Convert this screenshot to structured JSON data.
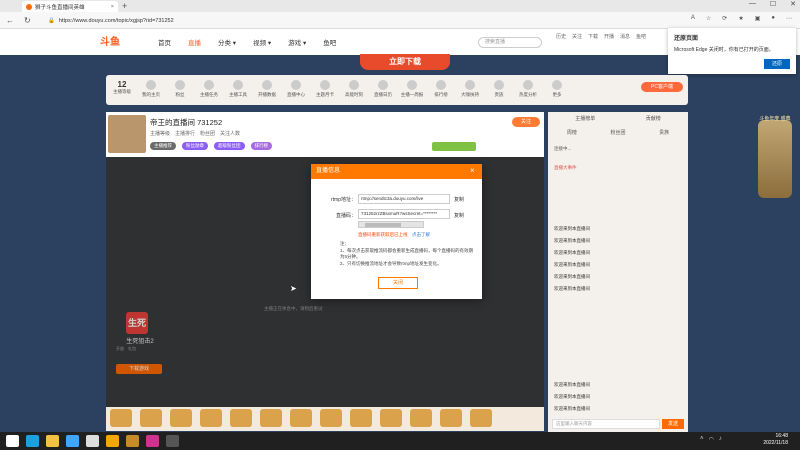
{
  "browser": {
    "tab_title": "狮子斗鱼直播间英雄",
    "tab_close": "×",
    "new_tab": "+",
    "url": "https://www.douyu.com/topic/xgjsp?rid=731252"
  },
  "site": {
    "logo": "斗鱼",
    "nav": [
      "首页",
      "直播",
      "分类 ▾",
      "视频 ▾",
      "游戏 ▾",
      "鱼吧"
    ],
    "banner": "立即下载",
    "search_placeholder": "搜索直播",
    "header_icons": [
      "历史",
      "关注",
      "下载",
      "开播",
      "消息",
      "鱼吧"
    ]
  },
  "toast": {
    "title": "还原页面",
    "message": "Microsoft Edge 关闭时，你有已打开的页面。",
    "button": "还原"
  },
  "categories": {
    "count": "12",
    "count_label": "主播等级",
    "items": [
      "我的主页",
      "粉丝",
      "主播任务",
      "主播工具",
      "开播数据",
      "直播中心",
      "主题月卡",
      "高能时刻",
      "直播日历",
      "主播一周报",
      "排行榜",
      "大咖扶持",
      "贵族",
      "热度分析",
      "更多"
    ],
    "pc_button": "PC客户端"
  },
  "room": {
    "title": "帝王的直播间 731252",
    "meta": [
      "主播等级",
      "主播排行",
      "粉丝团",
      "关注人数"
    ],
    "tags": [
      "主播推荐",
      "粉丝勋章",
      "超级粉丝团",
      "排行榜"
    ],
    "follow": "关注"
  },
  "player": {
    "status": "主播正在休息中，请稍后重试",
    "game_icon": "生死",
    "game_name": "生死狙击2",
    "game_sub": [
      "开放",
      "礼包"
    ],
    "game_button": "下载游戏"
  },
  "chat": {
    "tabs": [
      "主播榜单",
      "贡献榜"
    ],
    "tabs2": [
      "周榜",
      "粉丝团",
      "贵族"
    ],
    "lines": [
      "连接中...",
      "直播大事件",
      "欢迎来到本直播间",
      "欢迎来到本直播间",
      "欢迎来到本直播间",
      "欢迎来到本直播间",
      "欢迎来到本直播间",
      "欢迎来到本直播间",
      "欢迎来到本直播间",
      "欢迎来到本直播间",
      "欢迎来到本直播间"
    ],
    "input_placeholder": "这里输入聊天内容",
    "send": "发送"
  },
  "deco": {
    "text": "斗鱼年度 盛典"
  },
  "dialog": {
    "title": "直播信息",
    "close": "×",
    "rtmp_label": "rtmp地址：",
    "rtmp_value": "rtmp://sendtc3a.douyu.com/live",
    "copy1": "复制",
    "code_label": "直播码：",
    "code_value": "731252rzZBsxmuR?wsSecret=********",
    "copy2": "复制",
    "warn": "直播码重新获取后已上线",
    "warn_link": "点击了解",
    "notes_title": "注：",
    "notes": [
      "1、每次点击获取推流码都会重新生成直播码，每个直播码的有效期为5分钟。",
      "2、只有切换推流地址才会导致rtmp地址发生变化。"
    ],
    "close_button": "关闭"
  },
  "taskbar": {
    "time": "16:48",
    "date": "2022/11/18"
  }
}
